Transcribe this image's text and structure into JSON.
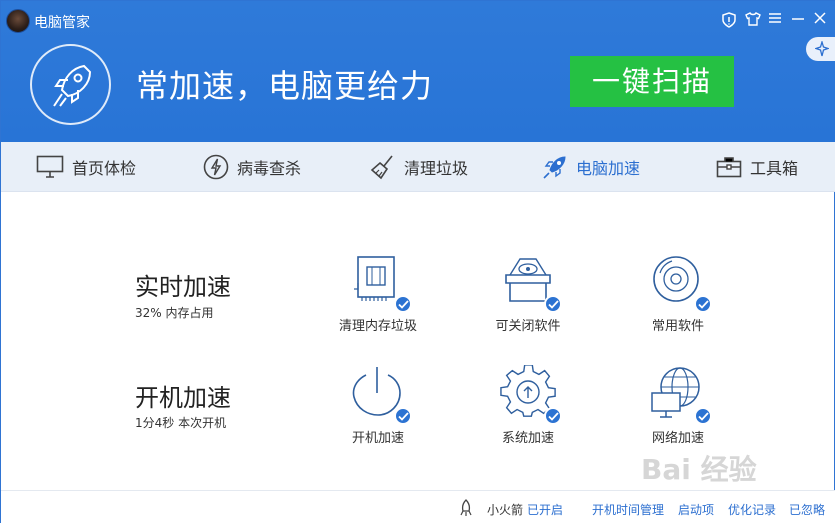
{
  "app": {
    "title": "电脑管家"
  },
  "header": {
    "slogan": "常加速，电脑更给力",
    "scan_button": "一键扫描"
  },
  "nav": [
    {
      "label": "首页体检",
      "icon": "monitor-icon"
    },
    {
      "label": "病毒查杀",
      "icon": "lightning-icon"
    },
    {
      "label": "清理垃圾",
      "icon": "broom-icon"
    },
    {
      "label": "电脑加速",
      "icon": "rocket-icon",
      "active": true
    },
    {
      "label": "工具箱",
      "icon": "toolbox-icon"
    }
  ],
  "realtime": {
    "title": "实时加速",
    "subtitle": "32% 内存占用",
    "items": [
      {
        "label": "清理内存垃圾",
        "icon": "memory-chip-icon"
      },
      {
        "label": "可关闭软件",
        "icon": "open-box-icon"
      },
      {
        "label": "常用软件",
        "icon": "disc-icon"
      }
    ]
  },
  "boot": {
    "title": "开机加速",
    "subtitle": "1分4秒 本次开机",
    "items": [
      {
        "label": "开机加速",
        "icon": "power-icon"
      },
      {
        "label": "系统加速",
        "icon": "gear-icon"
      },
      {
        "label": "网络加速",
        "icon": "globe-monitor-icon"
      }
    ]
  },
  "footer": {
    "rocket_label": "小火箭",
    "rocket_status": "已开启",
    "links": [
      "开机时间管理",
      "启动项",
      "优化记录",
      "已忽略"
    ]
  },
  "watermark": "Bai 经验",
  "colors": {
    "brand_blue": "#2874d6",
    "scan_green": "#25c143",
    "active_blue": "#2c6fd0"
  }
}
